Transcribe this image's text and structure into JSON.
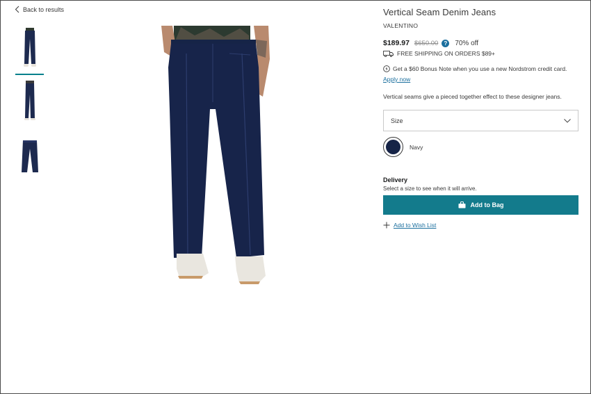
{
  "nav": {
    "back_label": "Back to results"
  },
  "gallery": {
    "thumbnails": [
      {
        "alt": "Front view"
      },
      {
        "alt": "Side view"
      },
      {
        "alt": "Flat view"
      }
    ],
    "active_index": 0
  },
  "product": {
    "title": "Vertical Seam Denim Jeans",
    "brand": "VALENTINO",
    "price": "$189.97",
    "original_price": "$650.00",
    "help_icon": "?",
    "discount": "70% off",
    "shipping": "FREE SHIPPING ON ORDERS $89+",
    "bonus_note": "Get a $60 Bonus Note when you use a new Nordstrom credit card.",
    "apply_label": "Apply now",
    "description": "Vertical seams give a pieced together effect to these designer jeans.",
    "size_label": "Size",
    "color_name": "Navy",
    "color_hex": "#162447",
    "delivery_heading": "Delivery",
    "delivery_note": "Select a size to see when it will arrive.",
    "add_to_bag_label": "Add to Bag",
    "wish_list_label": "Add to Wish List"
  },
  "colors": {
    "accent": "#137b8c",
    "link": "#1b6f9e",
    "text": "#393939"
  },
  "icons": [
    "chevron-left-icon",
    "help-icon",
    "truck-icon",
    "credit-card-icon",
    "chevron-down-icon",
    "bag-icon",
    "plus-icon"
  ]
}
